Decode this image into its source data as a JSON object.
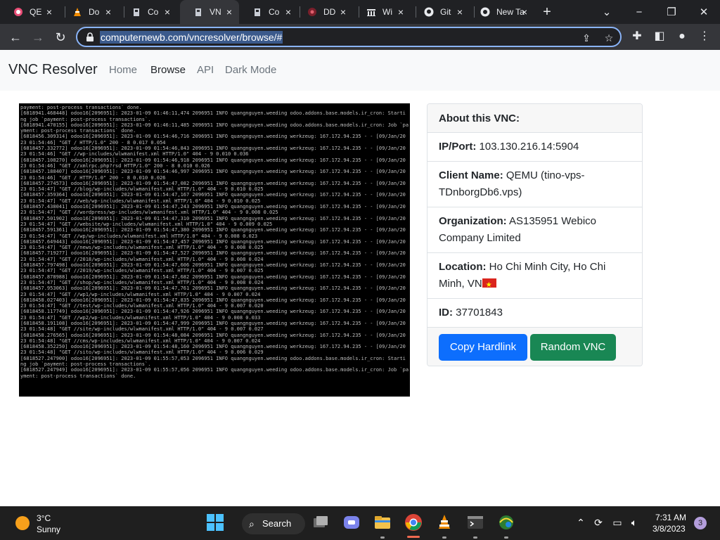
{
  "browser": {
    "tabs": [
      {
        "label": "QE",
        "icon": "pink-circle-icon",
        "active": false
      },
      {
        "label": "Do",
        "icon": "vlc-cone-icon",
        "active": false
      },
      {
        "label": "Co",
        "icon": "tardis-icon",
        "active": false
      },
      {
        "label": "VN",
        "icon": "tardis-icon",
        "active": true
      },
      {
        "label": "Co",
        "icon": "tardis-icon",
        "active": false
      },
      {
        "label": "DD",
        "icon": "ddos-icon",
        "active": false
      },
      {
        "label": "Wi",
        "icon": "wikipedia-icon",
        "active": false
      },
      {
        "label": "Git",
        "icon": "github-icon",
        "active": false
      },
      {
        "label": "New Ta",
        "icon": "chrome-icon",
        "active": false
      }
    ],
    "url": "computernewb.com/vncresolver/browse/#"
  },
  "site": {
    "brand": "VNC Resolver",
    "nav": {
      "home": "Home",
      "browse": "Browse",
      "api": "API",
      "dark_mode": "Dark Mode"
    }
  },
  "vnc_screenshot": {
    "log_lines": [
      "payment: post-process transactions` done.",
      "[6818941.468448] odoo16[2096951]: 2023-01-09 01:46:11,474 2096951 INFO quangnguyen.weeding odoo.addons.base.models.ir_cron: Starti",
      "ng job `payment: post-process transactions`.",
      "[6818941.470155] odoo16[2096951]: 2023-01-09 01:46:11,485 2096951 INFO quangnguyen.weeding odoo.addons.base.models.ir_cron: Job `pa",
      "yment: post-process transactions` done.",
      "[6818456.309314] odoo16[2096951]: 2023-01-09 01:54:46,716 2096951 INFO quangnguyen.weeding werkzeug: 167.172.94.235 - - [09/Jan/20",
      "23 01:54:46] \"GET / HTTP/1.0\" 200 - 8 0.017 0.054",
      "[6818457.332772] odoo16[2096951]: 2023-01-09 01:54:46,843 2096951 INFO quangnguyen.weeding werkzeug: 167.172.94.235 - - [09/Jan/20",
      "23 01:54:46] \"GET //wp-includes/wlwmanifest.xml HTTP/1.0\" 404 - 9 0.010 0.036",
      "[6818457.108270] odoo16[2096951]: 2023-01-09 01:54:46,918 2096951 INFO quangnguyen.weeding werkzeug: 167.172.94.235 - - [09/Jan/20",
      "23 01:54:46] \"GET //xmlrpc.php?rsd HTTP/1.0\" 200 - 8 0.010 0.026",
      "[6818457.188407] odoo16[2096951]: 2023-01-09 01:54:46,997 2096951 INFO quangnguyen.weeding werkzeug: 167.172.94.235 - - [09/Jan/20",
      "23 01:54:46] \"GET / HTTP/1.0\" 200 - 8 0.010 0.026",
      "[6818457.274573] odoo16[2096951]: 2023-01-09 01:54:47,082 2096951 INFO quangnguyen.weeding werkzeug: 167.172.94.235 - - [09/Jan/20",
      "23 01:54:47] \"GET //blog/wp-includes/wlwmanifest.xml HTTP/1.0\" 404 - 9 0.010 0.025",
      "[6818457.359364] odoo16[2096951]: 2023-01-09 01:54:47,167 2096951 INFO quangnguyen.weeding werkzeug: 167.172.94.235 - - [09/Jan/20",
      "23 01:54:47] \"GET //web/wp-includes/wlwmanifest.xml HTTP/1.0\" 404 - 9 0.010 0.025",
      "[6818457.438041] odoo16[2096951]: 2023-01-09 01:54:47,243 2096951 INFO quangnguyen.weeding werkzeug: 167.172.94.235 - - [09/Jan/20",
      "23 01:54:47] \"GET //wordpress/wp-includes/wlwmanifest.xml HTTP/1.0\" 404 - 9 0.008 0.025",
      "[6818457.501902] odoo16[2096951]: 2023-01-09 01:54:47,310 2096951 INFO quangnguyen.weeding werkzeug: 167.172.94.235 - - [09/Jan/20",
      "23 01:54:47] \"GET //website/wp-includes/wlwmanifest.xml HTTP/1.0\" 404 - 9 0.009 0.025",
      "[6818457.591361] odoo16[2096951]: 2023-01-09 01:54:47,380 2096951 INFO quangnguyen.weeding werkzeug: 167.172.94.235 - - [09/Jan/20",
      "23 01:54:47] \"GET //wp/wp-includes/wlwmanifest.xml HTTP/1.0\" 404 - 9 0.008 0.023",
      "[6818457.649443] odoo16[2096951]: 2023-01-09 01:54:47,457 2096951 INFO quangnguyen.weeding werkzeug: 167.172.94.235 - - [09/Jan/20",
      "23 01:54:47] \"GET //news/wp-includes/wlwmanifest.xml HTTP/1.0\" 404 - 9 0.008 0.025",
      "[6818457.719277] odoo16[2096951]: 2023-01-09 01:54:47,527 2096951 INFO quangnguyen.weeding werkzeug: 167.172.94.235 - - [09/Jan/20",
      "23 01:54:47] \"GET //2018/wp-includes/wlwmanifest.xml HTTP/1.0\" 404 - 9 0.008 0.024",
      "[6818457.797498] odoo16[2096951]: 2023-01-09 01:54:47,606 2096951 INFO quangnguyen.weeding werkzeug: 167.172.94.235 - - [09/Jan/20",
      "23 01:54:47] \"GET //2019/wp-includes/wlwmanifest.xml HTTP/1.0\" 404 - 9 0.007 0.025",
      "[6818457.878988] odoo16[2096951]: 2023-01-09 01:54:47,682 2096951 INFO quangnguyen.weeding werkzeug: 167.172.94.235 - - [09/Jan/20",
      "23 01:54:47] \"GET //shop/wp-includes/wlwmanifest.xml HTTP/1.0\" 404 - 9 0.008 0.024",
      "[6818457.953063] odoo16[2096951]: 2023-01-09 01:54:47,761 2096951 INFO quangnguyen.weeding werkzeug: 167.172.94.235 - - [09/Jan/20",
      "23 01:54:47] \"GET //wp1/wp-includes/wlwmanifest.xml HTTP/1.0\" 404 - 9 0.007 0.024",
      "[6818458.027403] odoo16[2096951]: 2023-01-09 01:54:47,835 2096951 INFO quangnguyen.weeding werkzeug: 167.172.94.235 - - [09/Jan/20",
      "23 01:54:47] \"GET //test/wp-includes/wlwmanifest.xml HTTP/1.0\" 404 - 9 0.007 0.020",
      "[6818458.117749] odoo16[2096951]: 2023-01-09 01:54:47,926 2096951 INFO quangnguyen.weeding werkzeug: 167.172.94.235 - - [09/Jan/20",
      "23 01:54:47] \"GET //wp2/wp-includes/wlwmanifest.xml HTTP/1.0\" 404 - 9 0.008 0.033",
      "[6818458.191108] odoo16[2096951]: 2023-01-09 01:54:47,999 2096951 INFO quangnguyen.weeding werkzeug: 167.172.94.235 - - [09/Jan/20",
      "23 01:54:48] \"GET //site/wp-includes/wlwmanifest.xml HTTP/1.0\" 404 - 9 0.007 0.027",
      "[6818458.276565] odoo16[2096951]: 2023-01-09 01:54:48,084 2096951 INFO quangnguyen.weeding werkzeug: 167.172.94.235 - - [09/Jan/20",
      "23 01:54:48] \"GET //cms/wp-includes/wlwmanifest.xml HTTP/1.0\" 404 - 9 0.007 0.024",
      "[6818458.352250] odoo16[2096951]: 2023-01-09 01:54:48,160 2096951 INFO quangnguyen.weeding werkzeug: 167.172.94.235 - - [09/Jan/20",
      "23 01:54:48] \"GET //sito/wp-includes/wlwmanifest.xml HTTP/1.0\" 404 - 9 0.006 0.029",
      "[6818527.247900] odoo16[2096951]: 2023-01-09 01:55:57,053 2096951 INFO quangnguyen.weeding odoo.addons.base.models.ir_cron: Starti",
      "ng job `payment: post-process transactions`.",
      "[6818527.247949] odoo16[2096951]: 2023-01-09 01:55:57,056 2096951 INFO quangnguyen.weeding odoo.addons.base.models.ir_cron: Job `pa",
      "yment: post-process transactions` done."
    ]
  },
  "about": {
    "title": "About this VNC:",
    "ip_label": "IP/Port:",
    "ip_value": "103.130.216.14:5904",
    "client_label": "Client Name:",
    "client_value": "QEMU (tino-vps-TDnborgDb6.vps)",
    "org_label": "Organization:",
    "org_value": "AS135951 Webico Company Limited",
    "location_label": "Location:",
    "location_value": "Ho Chi Minh City, Ho Chi Minh, VN",
    "id_label": "ID:",
    "id_value": "37701843",
    "copy_button": "Copy Hardlink",
    "random_button": "Random VNC"
  },
  "colors": {
    "primary": "#0d6efd",
    "success": "#198754",
    "flag_red": "#da251d"
  },
  "taskbar": {
    "temperature": "3°C",
    "weather": "Sunny",
    "search_label": "Search",
    "time": "7:31 AM",
    "date": "3/8/2023",
    "notification_count": "3"
  }
}
